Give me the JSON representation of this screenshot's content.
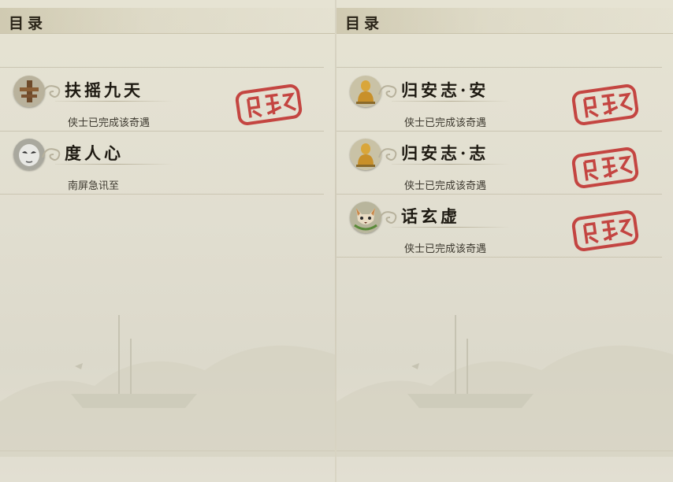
{
  "panels": [
    {
      "header_title": "目录",
      "entries": [
        {
          "title": "扶摇九天",
          "description": "侠士已完成该奇遇",
          "icon": "wooden-post-icon",
          "completed": true
        },
        {
          "title": "度人心",
          "description": "南屏急讯至",
          "icon": "mask-icon",
          "completed": false
        }
      ]
    },
    {
      "header_title": "目录",
      "entries": [
        {
          "title": "归安志·安",
          "description": "侠士已完成该奇遇",
          "icon": "golden-buddha-icon",
          "completed": true
        },
        {
          "title": "归安志·志",
          "description": "侠士已完成该奇遇",
          "icon": "golden-buddha-icon",
          "completed": true
        },
        {
          "title": "话玄虚",
          "description": "侠士已完成该奇遇",
          "icon": "fox-face-icon",
          "completed": true
        }
      ]
    }
  ],
  "colors": {
    "stamp_red": "#c0302e",
    "background": "#e3e0d0",
    "text_dark": "#1e1a12"
  }
}
